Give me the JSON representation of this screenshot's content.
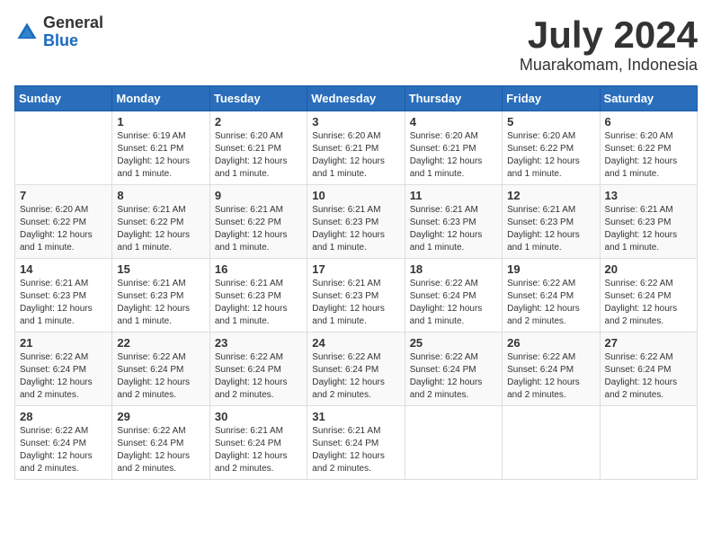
{
  "header": {
    "logo_general": "General",
    "logo_blue": "Blue",
    "month_year": "July 2024",
    "location": "Muarakomam, Indonesia"
  },
  "weekdays": [
    "Sunday",
    "Monday",
    "Tuesday",
    "Wednesday",
    "Thursday",
    "Friday",
    "Saturday"
  ],
  "weeks": [
    [
      {
        "day": "",
        "sunrise": "",
        "sunset": "",
        "daylight": ""
      },
      {
        "day": "1",
        "sunrise": "Sunrise: 6:19 AM",
        "sunset": "Sunset: 6:21 PM",
        "daylight": "Daylight: 12 hours and 1 minute."
      },
      {
        "day": "2",
        "sunrise": "Sunrise: 6:20 AM",
        "sunset": "Sunset: 6:21 PM",
        "daylight": "Daylight: 12 hours and 1 minute."
      },
      {
        "day": "3",
        "sunrise": "Sunrise: 6:20 AM",
        "sunset": "Sunset: 6:21 PM",
        "daylight": "Daylight: 12 hours and 1 minute."
      },
      {
        "day": "4",
        "sunrise": "Sunrise: 6:20 AM",
        "sunset": "Sunset: 6:21 PM",
        "daylight": "Daylight: 12 hours and 1 minute."
      },
      {
        "day": "5",
        "sunrise": "Sunrise: 6:20 AM",
        "sunset": "Sunset: 6:22 PM",
        "daylight": "Daylight: 12 hours and 1 minute."
      },
      {
        "day": "6",
        "sunrise": "Sunrise: 6:20 AM",
        "sunset": "Sunset: 6:22 PM",
        "daylight": "Daylight: 12 hours and 1 minute."
      }
    ],
    [
      {
        "day": "7",
        "sunrise": "Sunrise: 6:20 AM",
        "sunset": "Sunset: 6:22 PM",
        "daylight": "Daylight: 12 hours and 1 minute."
      },
      {
        "day": "8",
        "sunrise": "Sunrise: 6:21 AM",
        "sunset": "Sunset: 6:22 PM",
        "daylight": "Daylight: 12 hours and 1 minute."
      },
      {
        "day": "9",
        "sunrise": "Sunrise: 6:21 AM",
        "sunset": "Sunset: 6:22 PM",
        "daylight": "Daylight: 12 hours and 1 minute."
      },
      {
        "day": "10",
        "sunrise": "Sunrise: 6:21 AM",
        "sunset": "Sunset: 6:23 PM",
        "daylight": "Daylight: 12 hours and 1 minute."
      },
      {
        "day": "11",
        "sunrise": "Sunrise: 6:21 AM",
        "sunset": "Sunset: 6:23 PM",
        "daylight": "Daylight: 12 hours and 1 minute."
      },
      {
        "day": "12",
        "sunrise": "Sunrise: 6:21 AM",
        "sunset": "Sunset: 6:23 PM",
        "daylight": "Daylight: 12 hours and 1 minute."
      },
      {
        "day": "13",
        "sunrise": "Sunrise: 6:21 AM",
        "sunset": "Sunset: 6:23 PM",
        "daylight": "Daylight: 12 hours and 1 minute."
      }
    ],
    [
      {
        "day": "14",
        "sunrise": "Sunrise: 6:21 AM",
        "sunset": "Sunset: 6:23 PM",
        "daylight": "Daylight: 12 hours and 1 minute."
      },
      {
        "day": "15",
        "sunrise": "Sunrise: 6:21 AM",
        "sunset": "Sunset: 6:23 PM",
        "daylight": "Daylight: 12 hours and 1 minute."
      },
      {
        "day": "16",
        "sunrise": "Sunrise: 6:21 AM",
        "sunset": "Sunset: 6:23 PM",
        "daylight": "Daylight: 12 hours and 1 minute."
      },
      {
        "day": "17",
        "sunrise": "Sunrise: 6:21 AM",
        "sunset": "Sunset: 6:23 PM",
        "daylight": "Daylight: 12 hours and 1 minute."
      },
      {
        "day": "18",
        "sunrise": "Sunrise: 6:22 AM",
        "sunset": "Sunset: 6:24 PM",
        "daylight": "Daylight: 12 hours and 1 minute."
      },
      {
        "day": "19",
        "sunrise": "Sunrise: 6:22 AM",
        "sunset": "Sunset: 6:24 PM",
        "daylight": "Daylight: 12 hours and 2 minutes."
      },
      {
        "day": "20",
        "sunrise": "Sunrise: 6:22 AM",
        "sunset": "Sunset: 6:24 PM",
        "daylight": "Daylight: 12 hours and 2 minutes."
      }
    ],
    [
      {
        "day": "21",
        "sunrise": "Sunrise: 6:22 AM",
        "sunset": "Sunset: 6:24 PM",
        "daylight": "Daylight: 12 hours and 2 minutes."
      },
      {
        "day": "22",
        "sunrise": "Sunrise: 6:22 AM",
        "sunset": "Sunset: 6:24 PM",
        "daylight": "Daylight: 12 hours and 2 minutes."
      },
      {
        "day": "23",
        "sunrise": "Sunrise: 6:22 AM",
        "sunset": "Sunset: 6:24 PM",
        "daylight": "Daylight: 12 hours and 2 minutes."
      },
      {
        "day": "24",
        "sunrise": "Sunrise: 6:22 AM",
        "sunset": "Sunset: 6:24 PM",
        "daylight": "Daylight: 12 hours and 2 minutes."
      },
      {
        "day": "25",
        "sunrise": "Sunrise: 6:22 AM",
        "sunset": "Sunset: 6:24 PM",
        "daylight": "Daylight: 12 hours and 2 minutes."
      },
      {
        "day": "26",
        "sunrise": "Sunrise: 6:22 AM",
        "sunset": "Sunset: 6:24 PM",
        "daylight": "Daylight: 12 hours and 2 minutes."
      },
      {
        "day": "27",
        "sunrise": "Sunrise: 6:22 AM",
        "sunset": "Sunset: 6:24 PM",
        "daylight": "Daylight: 12 hours and 2 minutes."
      }
    ],
    [
      {
        "day": "28",
        "sunrise": "Sunrise: 6:22 AM",
        "sunset": "Sunset: 6:24 PM",
        "daylight": "Daylight: 12 hours and 2 minutes."
      },
      {
        "day": "29",
        "sunrise": "Sunrise: 6:22 AM",
        "sunset": "Sunset: 6:24 PM",
        "daylight": "Daylight: 12 hours and 2 minutes."
      },
      {
        "day": "30",
        "sunrise": "Sunrise: 6:21 AM",
        "sunset": "Sunset: 6:24 PM",
        "daylight": "Daylight: 12 hours and 2 minutes."
      },
      {
        "day": "31",
        "sunrise": "Sunrise: 6:21 AM",
        "sunset": "Sunset: 6:24 PM",
        "daylight": "Daylight: 12 hours and 2 minutes."
      },
      {
        "day": "",
        "sunrise": "",
        "sunset": "",
        "daylight": ""
      },
      {
        "day": "",
        "sunrise": "",
        "sunset": "",
        "daylight": ""
      },
      {
        "day": "",
        "sunrise": "",
        "sunset": "",
        "daylight": ""
      }
    ]
  ]
}
